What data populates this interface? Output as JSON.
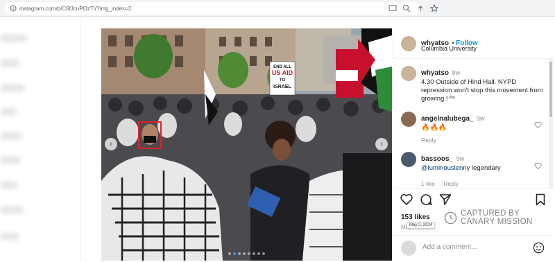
{
  "browser": {
    "url": "instagram.com/p/C6fJcuPOzTI/?img_index=2",
    "icons": [
      "page-info-icon",
      "cast-icon",
      "zoom-icon",
      "bookmark-star-icon"
    ]
  },
  "post": {
    "author": {
      "username": "whyatso",
      "follow_label": "Follow",
      "location": "Columbia University"
    },
    "caption": {
      "username": "whyatso",
      "time": "9w",
      "text": "4.30 Outside of Hind Hall. NYPD repression won't stop this movement from growing ! ᴾˢ"
    },
    "comments": [
      {
        "username": "angelnalubega_",
        "time": "9w",
        "text": "🔥🔥🔥",
        "reply_label": "Reply"
      },
      {
        "username": "bassoos_",
        "time": "9w",
        "mention": "@luminouslenny",
        "text": " legendary",
        "likes": "1 like",
        "reply_label": "Reply"
      }
    ],
    "likes": "153 likes",
    "date": "May 2",
    "date_tooltip": "May 2, 2024",
    "add_comment_placeholder": "Add a comment...",
    "photo_signs": {
      "sign1_line1": "END ALL",
      "sign1_line2": "US AID",
      "sign1_line3": "TO",
      "sign1_line4": "ISRAEL"
    }
  },
  "watermark": {
    "line1": "CAPTURED BY",
    "line2": "CANARY MISSION"
  },
  "colors": {
    "accent": "#0095f6",
    "highlight_box": "#e0212b",
    "dot_active": "#3897f0"
  }
}
